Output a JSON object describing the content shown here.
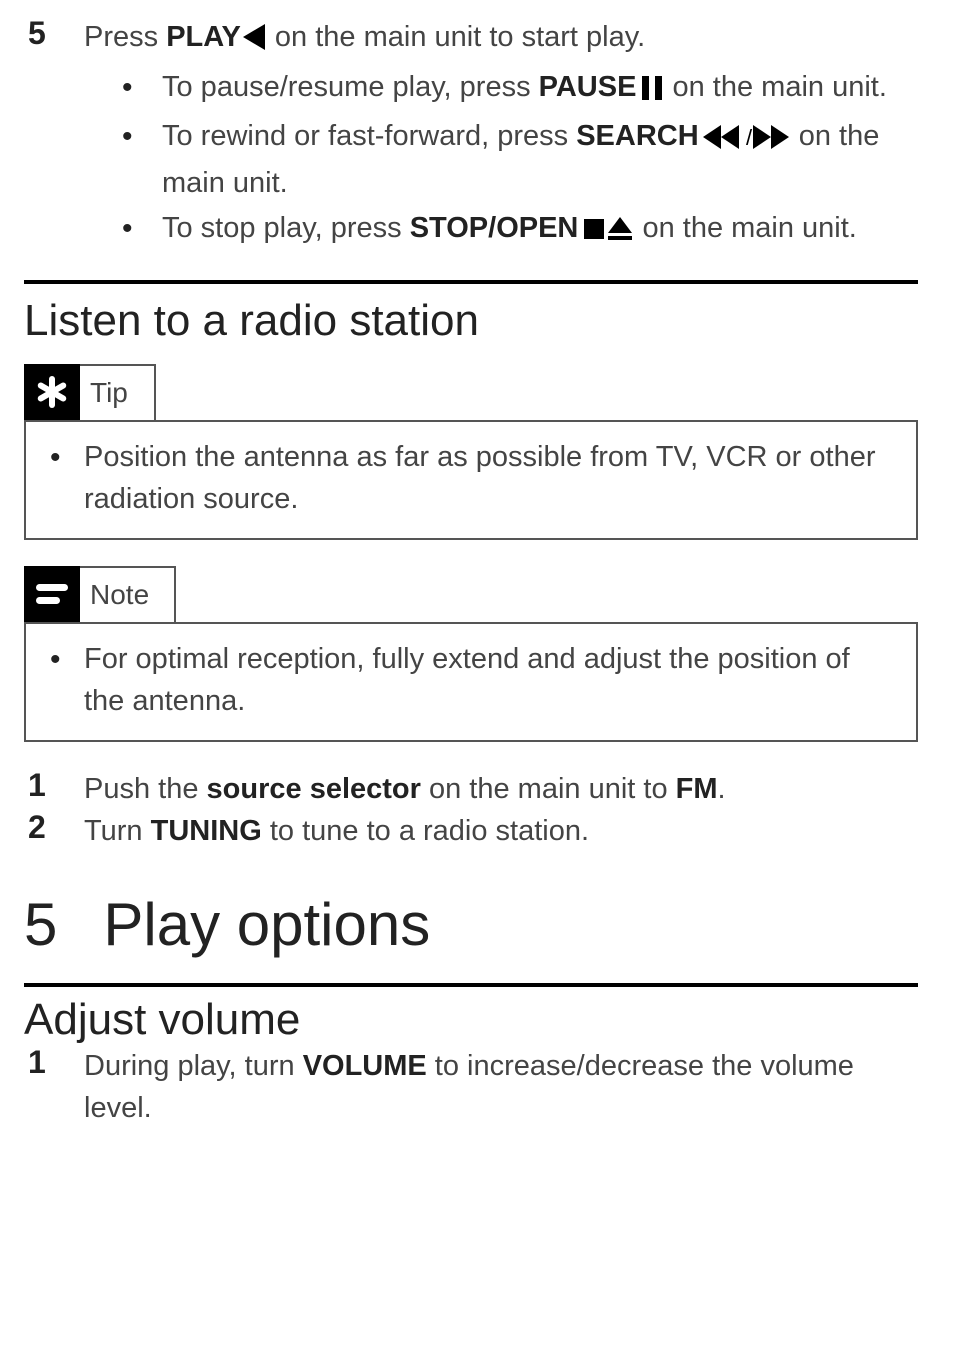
{
  "top": {
    "step5_num": "5",
    "step5_pre": "Press ",
    "step5_b": "PLAY",
    "step5_post": " on the main unit to start play.",
    "bullets": {
      "b1_pre": "To pause/resume play, press ",
      "b1_b": "PAUSE",
      "b1_post": " on the main unit.",
      "b2_pre": "To rewind or fast-forward, press ",
      "b2_b": "SEARCH",
      "b2_post": " on the main unit.",
      "b3_pre": "To stop play, press ",
      "b3_b": "STOP/OPEN",
      "b3_post": " on the main unit."
    }
  },
  "radio": {
    "heading": "Listen to a radio station",
    "tip_label": "Tip",
    "tip_text": "Position the antenna as far as possible from TV, VCR or other radiation source.",
    "note_label": "Note",
    "note_text": "For optimal reception, fully extend and adjust the position of the antenna.",
    "step1_num": "1",
    "step1_pre": "Push the ",
    "step1_b1": "source selector",
    "step1_mid": " on the main unit to ",
    "step1_b2": "FM",
    "step1_post": ".",
    "step2_num": "2",
    "step2_pre": "Turn ",
    "step2_b": "TUNING",
    "step2_post": " to tune to a radio station."
  },
  "chapter5": {
    "num": "5",
    "title": "Play options"
  },
  "volume": {
    "heading": "Adjust volume",
    "step1_num": "1",
    "step1_pre": "During play, turn ",
    "step1_b": "VOLUME",
    "step1_post": " to increase/decrease the volume level."
  }
}
